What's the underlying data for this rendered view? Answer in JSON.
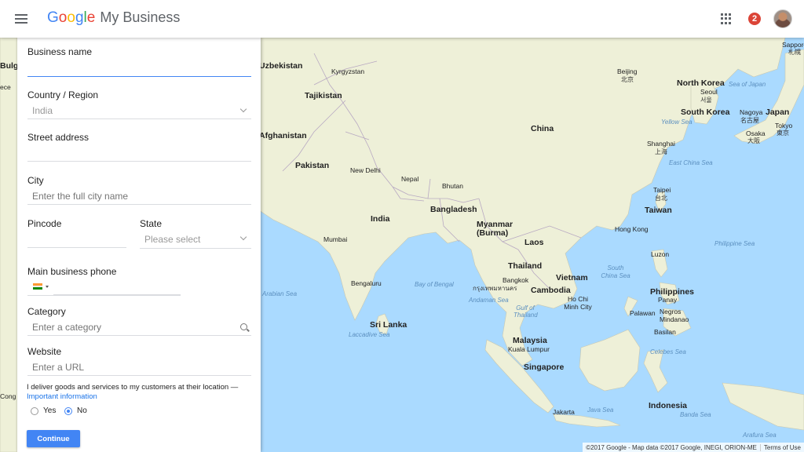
{
  "header": {
    "logo_letters": [
      "G",
      "o",
      "o",
      "g",
      "l",
      "e"
    ],
    "product": "My Business",
    "notification_count": "2"
  },
  "form": {
    "business_name": {
      "label": "Business name",
      "value": ""
    },
    "country": {
      "label": "Country / Region",
      "value": "India"
    },
    "street": {
      "label": "Street address",
      "value": ""
    },
    "city": {
      "label": "City",
      "placeholder": "Enter the full city name"
    },
    "pincode": {
      "label": "Pincode",
      "value": ""
    },
    "state": {
      "label": "State",
      "placeholder": "Please select"
    },
    "phone": {
      "label": "Main business phone",
      "value": "",
      "flag_colors": [
        "#ff9933",
        "#ffffff",
        "#138808"
      ]
    },
    "category": {
      "label": "Category",
      "placeholder": "Enter a category"
    },
    "website": {
      "label": "Website",
      "placeholder": "Enter a URL"
    },
    "deliver": {
      "text": "I deliver goods and services to my customers at their location —",
      "link": "Important information",
      "options": [
        {
          "label": "Yes",
          "checked": false
        },
        {
          "label": "No",
          "checked": true
        }
      ]
    },
    "continue_label": "Continue"
  },
  "map": {
    "countries": [
      "Uzbekistan",
      "Kyrgyzstan",
      "Tajikistan",
      "Afghanistan",
      "Pakistan",
      "Nepal",
      "Bhutan",
      "India",
      "Bangladesh",
      "Myanmar (Burma)",
      "Laos",
      "Thailand",
      "Vietnam",
      "Cambodia",
      "Malaysia",
      "Singapore",
      "Sri Lanka",
      "Philippines",
      "Indonesia",
      "China",
      "North Korea",
      "South Korea",
      "Japan",
      "Taiwan",
      "Bulg",
      "ece",
      "Cong"
    ],
    "cities": [
      "New Delhi",
      "Mumbai",
      "Bengaluru",
      "Beijing",
      "Seoul",
      "Shanghai",
      "Taipei",
      "Hong Kong",
      "Bangkok",
      "Ho Chi Minh City",
      "Kuala Lumpur",
      "Jakarta",
      "Nagoya",
      "Osaka",
      "Tokyo",
      "Sapporo",
      "Luzon",
      "Panay",
      "Negros",
      "Mindanao",
      "Palawan",
      "Basilan"
    ],
    "cjk": [
      "北京",
      "서울",
      "上海",
      "台北",
      "名古屋",
      "大阪",
      "東京",
      "札幌",
      "กรุงเทพมหานคร"
    ],
    "seas": [
      "Sea of Japan",
      "Yellow Sea",
      "East China Sea",
      "South China Sea",
      "Philippine Sea",
      "Bay of Bengal",
      "Arabian Sea",
      "Andaman Sea",
      "Gulf of Thailand",
      "Laccadive Sea",
      "Celebes Sea",
      "Java Sea",
      "Banda Sea",
      "Arafura Sea"
    ],
    "attribution": "©2017 Google - Map data ©2017 Google, INEGI, ORION-ME",
    "terms": "Terms of Use",
    "land_color": "#eef0d8",
    "water_color": "#aadaff"
  }
}
